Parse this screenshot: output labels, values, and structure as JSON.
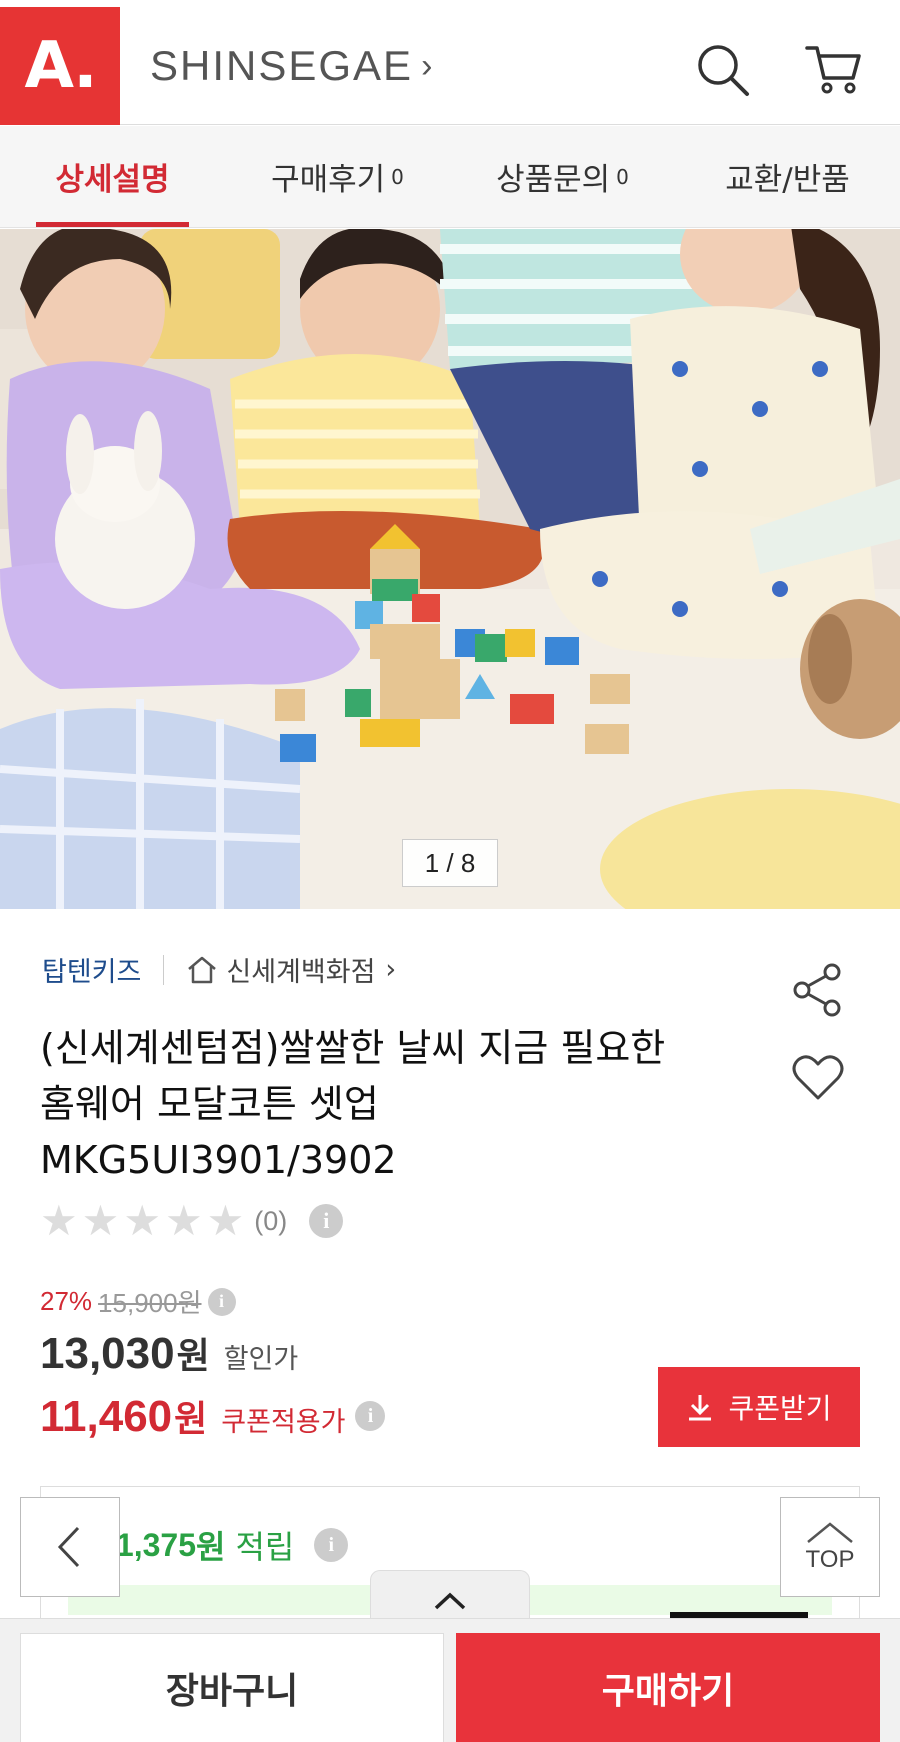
{
  "header": {
    "logo_text": "A.",
    "brand": "SHINSEGAE",
    "brand_chevron": "›",
    "icons": [
      "search-icon",
      "cart-icon"
    ],
    "accent_color": "#e63434"
  },
  "tabs": [
    {
      "label": "상세설명",
      "count": ""
    },
    {
      "label": "구매후기",
      "count": "0"
    },
    {
      "label": "상품문의",
      "count": "0"
    },
    {
      "label": "교환/반품",
      "count": ""
    }
  ],
  "gallery": {
    "pager": "1 / 8"
  },
  "product": {
    "brand": "탑텐키즈",
    "store": "신세계백화점",
    "store_chevron": "›",
    "title_line1": "(신세계센텀점)쌀쌀한 날씨 지금 필요한",
    "title_line2": "홈웨어 모달코튼 셋업",
    "title_line3": "MKG5UI3901/3902",
    "rating_stars": 0,
    "review_count": "(0)",
    "discount_pct": "27%",
    "original_price": "15,900원",
    "sale_price": "13,030",
    "sale_won": "원",
    "sale_label": "할인가",
    "coupon_price": "11,460",
    "coupon_won": "원",
    "coupon_label": "쿠폰적용가",
    "coupon_button": "쿠폰받기",
    "points_prefix": "I",
    "points_amount": "1,375",
    "points_won": "원",
    "points_label": "적립"
  },
  "floating": {
    "top_label": "TOP"
  },
  "bottom_bar": {
    "cart": "장바구니",
    "buy": "구매하기"
  }
}
